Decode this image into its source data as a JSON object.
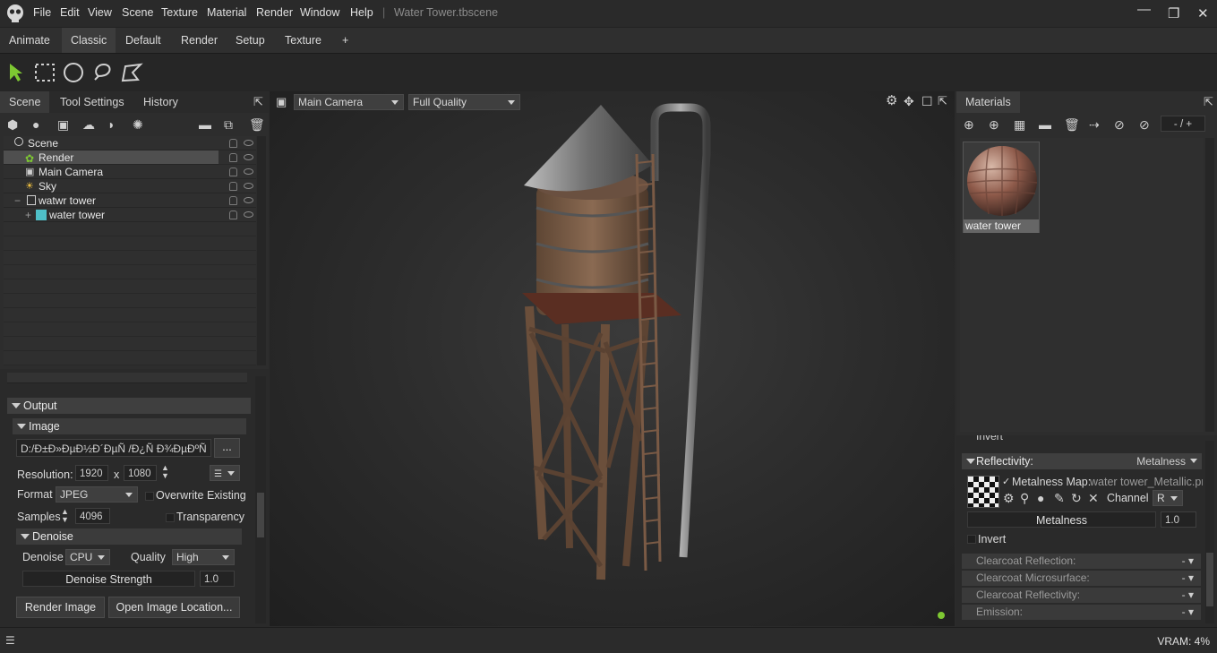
{
  "app": {
    "document_title": "Water Tower.tbscene",
    "menu": [
      "File",
      "Edit",
      "View",
      "Scene",
      "Texture",
      "Material",
      "Render",
      "Window",
      "Help"
    ]
  },
  "workspace_tabs": [
    "Animate",
    "Classic",
    "Default",
    "Render",
    "Setup",
    "Texture",
    "+"
  ],
  "active_workspace": "Classic",
  "left_panel": {
    "tabs": [
      "Scene",
      "Tool Settings",
      "History"
    ],
    "active_tab": "Scene",
    "tree": [
      {
        "label": "Scene",
        "icon": "scene-icon"
      },
      {
        "label": "Render",
        "icon": "render-icon",
        "selected": true
      },
      {
        "label": "Main Camera",
        "icon": "camera-icon"
      },
      {
        "label": "Sky",
        "icon": "sky-icon"
      },
      {
        "label": "watwr tower",
        "icon": "object-icon"
      },
      {
        "label": "water tower",
        "icon": "mesh-icon"
      }
    ]
  },
  "output": {
    "section_title": "Output",
    "image_title": "Image",
    "path_value": "D:/Đ±Đ»ĐµĐ½Đ´ĐµÑ  /Đ¿Ñ  Đ¾ĐµĐºÑ",
    "browse_label": "...",
    "resolution_label": "Resolution:",
    "width": "1920",
    "x_label": "x",
    "height": "1080",
    "format_label": "Format",
    "format_value": "JPEG",
    "overwrite_label": "Overwrite Existing",
    "samples_label": "Samples",
    "samples_value": "4096",
    "transparency_label": "Transparency",
    "denoise_title": "Denoise",
    "denoise_label": "Denoise",
    "denoise_value": "CPU",
    "quality_label": "Quality",
    "quality_value": "High",
    "denoise_strength_label": "Denoise Strength",
    "denoise_strength_value": "1.0",
    "render_image_label": "Render Image",
    "open_location_label": "Open Image Location..."
  },
  "viewport": {
    "camera_value": "Main Camera",
    "quality_value": "Full Quality"
  },
  "materials_panel": {
    "title": "Materials",
    "counter": "- / +",
    "material_name": "water tower",
    "invert_partial": "Invert",
    "reflectivity_label": "Reflectivity:",
    "reflectivity_value": "Metalness",
    "metalness_map_label": "Metalness Map:",
    "metalness_map_file": "water tower_Metallic.pn",
    "channel_label": "Channel",
    "channel_value": "R",
    "metalness_label": "Metalness",
    "metalness_value": "1.0",
    "invert_label": "Invert",
    "collapsed_sections": [
      {
        "label": "Clearcoat Reflection:",
        "value": "-"
      },
      {
        "label": "Clearcoat Microsurface:",
        "value": "-"
      },
      {
        "label": "Clearcoat Reflectivity:",
        "value": "-"
      },
      {
        "label": "Emission:",
        "value": "-"
      }
    ]
  },
  "status": {
    "vram": "VRAM: 4%"
  },
  "colors": {
    "accent_green": "#7ec832",
    "background": "#2b2b2b",
    "panel": "#2d2d2d"
  }
}
